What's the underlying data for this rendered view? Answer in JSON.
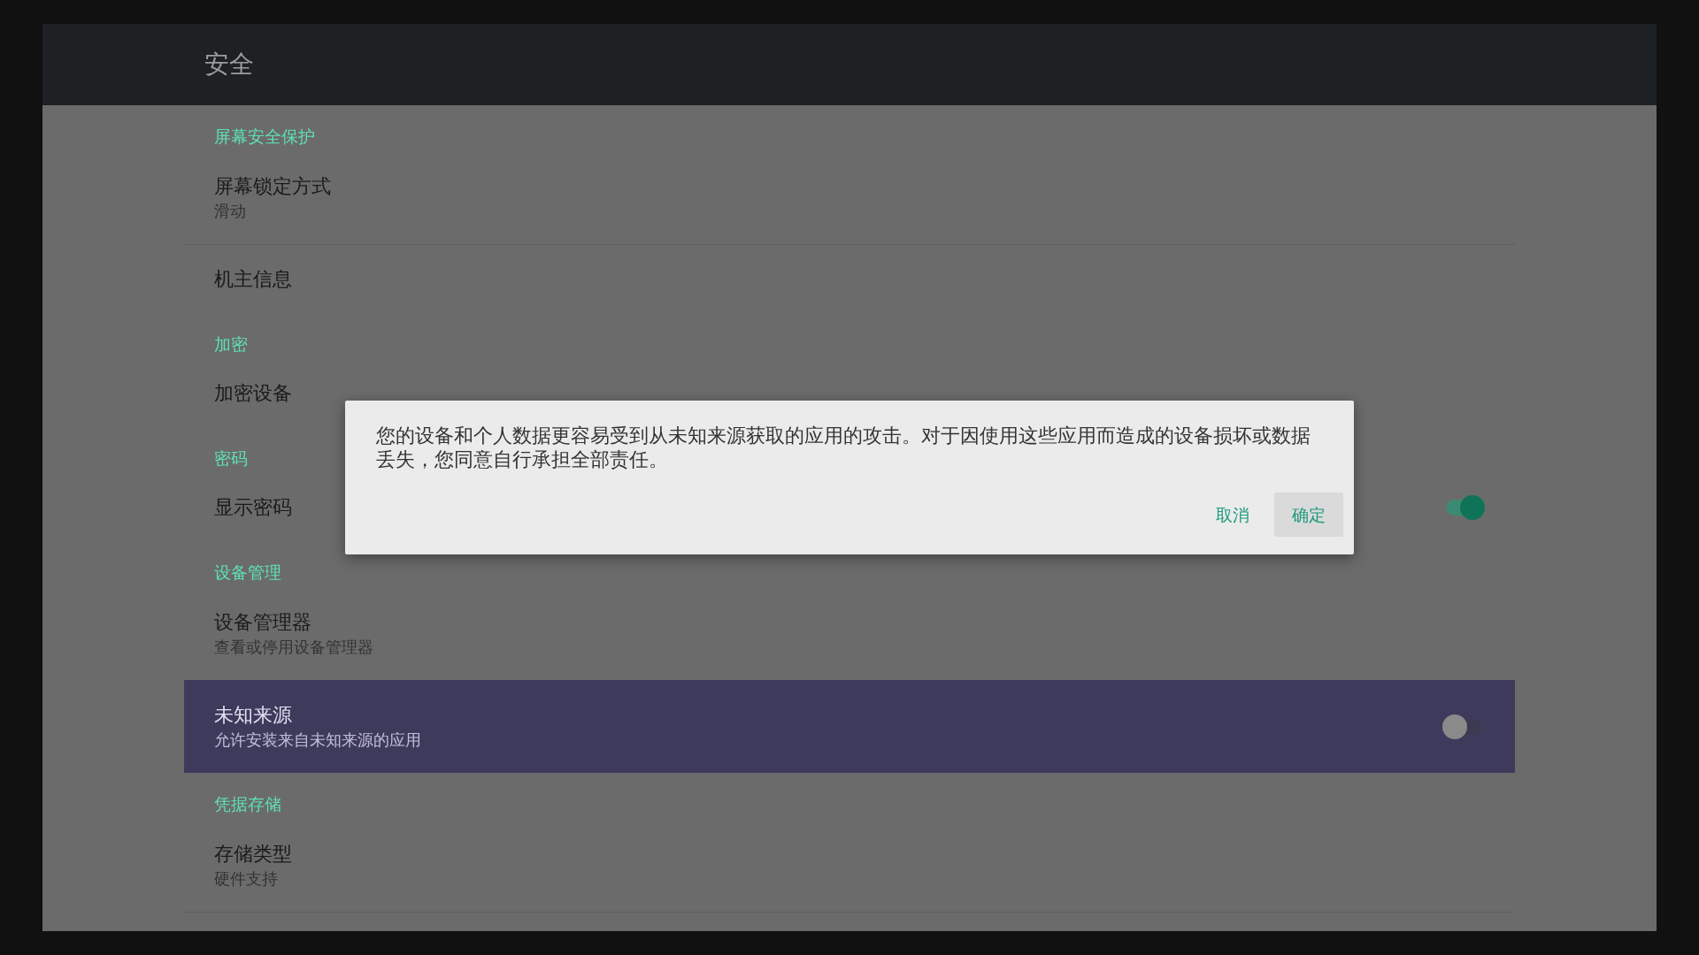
{
  "header": {
    "title": "安全"
  },
  "rows": [
    {
      "kind": "category",
      "title": "屏幕安全保护"
    },
    {
      "kind": "preference",
      "title": "屏幕锁定方式",
      "summary": "滑动",
      "selected": false
    },
    {
      "kind": "divider"
    },
    {
      "kind": "preference",
      "title": "机主信息",
      "selected": false
    },
    {
      "kind": "category",
      "title": "加密"
    },
    {
      "kind": "preference",
      "title": "加密设备",
      "selected": false
    },
    {
      "kind": "category",
      "title": "密码"
    },
    {
      "kind": "switch",
      "title": "显示密码",
      "selected": false,
      "on": true
    },
    {
      "kind": "category",
      "title": "设备管理"
    },
    {
      "kind": "preference",
      "title": "设备管理器",
      "summary": "查看或停用设备管理器",
      "selected": false
    },
    {
      "kind": "switch",
      "title": "未知来源",
      "summary": "允许安装来自未知来源的应用",
      "selected": true,
      "on": false
    },
    {
      "kind": "category",
      "title": "凭据存储"
    },
    {
      "kind": "preference",
      "title": "存储类型",
      "summary": "硬件支持",
      "selected": false
    },
    {
      "kind": "divider"
    }
  ],
  "dialog": {
    "message": "您的设备和个人数据更容易受到从未知来源获取的应用的攻击。对于因使用这些应用而造成的设备损坏或数据丢失，您同意自行承担全部责任。",
    "buttons": [
      {
        "label": "取消",
        "selected": false
      },
      {
        "label": "确定",
        "selected": true
      }
    ]
  }
}
